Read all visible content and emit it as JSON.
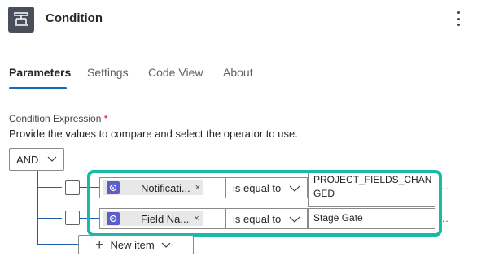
{
  "header": {
    "title": "Condition",
    "icon": "condition-icon"
  },
  "tabs": [
    {
      "label": "Parameters",
      "active": true
    },
    {
      "label": "Settings",
      "active": false
    },
    {
      "label": "Code View",
      "active": false
    },
    {
      "label": "About",
      "active": false
    }
  ],
  "condition": {
    "label": "Condition Expression",
    "required_mark": "*",
    "description": "Provide the values to compare and select the operator to use.",
    "group_operator": "AND",
    "rows": [
      {
        "token_label": "Notificati...",
        "token_close": "×",
        "operator": "is equal to",
        "value_line1": "PROJECT_FIELDS_CHAN",
        "value_line2": "GED"
      },
      {
        "token_label": "Field Na...",
        "token_close": "×",
        "operator": "is equal to",
        "value_line1": "Stage Gate"
      }
    ],
    "row_more": "..",
    "new_item_label": "New item"
  },
  "colors": {
    "accent": "#0f6cbd",
    "highlight": "#1ab8a7",
    "token_icon": "#5b5fc7",
    "tree_line": "#1b5ea7"
  }
}
